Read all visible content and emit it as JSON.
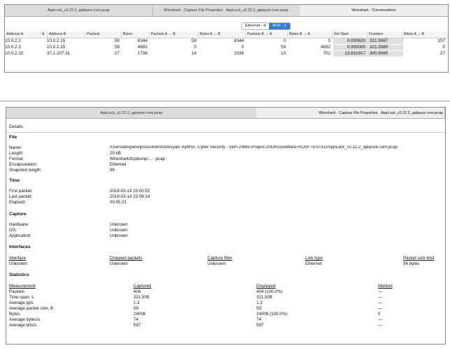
{
  "conversations": {
    "tabs": [
      "AppLock_v2.22.2_apkpure.com.pcap",
      "Wireshark · Capture File Properties · AppLock_v2.22.2_apkpure.com.pcap",
      "Wireshark · Conversations"
    ],
    "segment": {
      "ethernet": "Ethernet · 4",
      "ipv4": "IPv4 · 3"
    },
    "columns": [
      "Address A",
      "A",
      "Address B",
      "Packets",
      "Bytes",
      "Packets A → B",
      "Bytes A → B",
      "Packets B → A",
      "Bytes B → A",
      "Rel Start",
      "Duration",
      "Bits/s A → B"
    ],
    "rows": [
      [
        "10.0.2.2",
        "",
        "10.0.2.15",
        "59",
        "6344",
        "59",
        "6344",
        "0",
        "0",
        "0.000620",
        "321.5087",
        "157"
      ],
      [
        "10.0.2.3",
        "",
        "10.0.2.15",
        "59",
        "4692",
        "0",
        "0",
        "59",
        "4692",
        "0.000000",
        "321.5080",
        "0"
      ],
      [
        "10.0.2.15",
        "",
        "37.1.207.31",
        "27",
        "1738",
        "14",
        "1036",
        "13",
        "702",
        "13.831917",
        "300.9065",
        "27"
      ]
    ]
  },
  "properties": {
    "tabs": [
      "AppLock_v2.22.2_apkpure.com.pcap",
      "Wireshark · Capture File Properties · AppLock_v2.22.2_apkpure.com.pcap"
    ],
    "details_title": "Details",
    "file": {
      "heading": "File",
      "labels": [
        "Name:",
        "Length:",
        "Format:",
        "Encapsulation:",
        "Snapshot length:"
      ],
      "values": [
        "/Users/devyanivij/Documents/Devyani Vij/MSc. Cyber Security - Sem 2/Mini-Project-2019/GoodWare-PCAP-TESTED/AppLock_v2.22.2_apkpure.com.pcap",
        "29 kB",
        "Wireshark/tcpdump/... - pcap",
        "Ethernet",
        "96"
      ]
    },
    "time": {
      "heading": "Time",
      "labels": [
        "First packet:",
        "Last packet:",
        "Elapsed:"
      ],
      "values": [
        "2019-03-14 23:00:52",
        "2019-03-14 23:06:14",
        "00:05:21"
      ]
    },
    "capture": {
      "heading": "Capture",
      "labels": [
        "Hardware:",
        "OS:",
        "Application:"
      ],
      "values": [
        "Unknown",
        "Unknown",
        "Unknown"
      ]
    },
    "interfaces": {
      "heading": "Interfaces",
      "columns": [
        "Interface",
        "Dropped packets",
        "Capture filter",
        "Link type",
        "Packet size limit"
      ],
      "row": [
        "Unknown",
        "Unknown",
        "Unknown",
        "Ethernet",
        "96 bytes"
      ]
    },
    "statistics": {
      "heading": "Statistics",
      "columns": [
        "Measurement",
        "Captured",
        "Displayed",
        "Marked"
      ],
      "rows": [
        [
          "Packets",
          "404",
          "404 (100.0%)",
          "—"
        ],
        [
          "Time span, s",
          "321.509",
          "321.509",
          "—"
        ],
        [
          "Average pps",
          "1.3",
          "1.3",
          "—"
        ],
        [
          "Average packet size, B",
          "59",
          "59",
          "—"
        ],
        [
          "Bytes",
          "24008",
          "24008 (100.0%)",
          "0"
        ],
        [
          "Average bytes/s",
          "74",
          "74",
          "—"
        ],
        [
          "Average bits/s",
          "597",
          "597",
          "—"
        ]
      ]
    }
  }
}
